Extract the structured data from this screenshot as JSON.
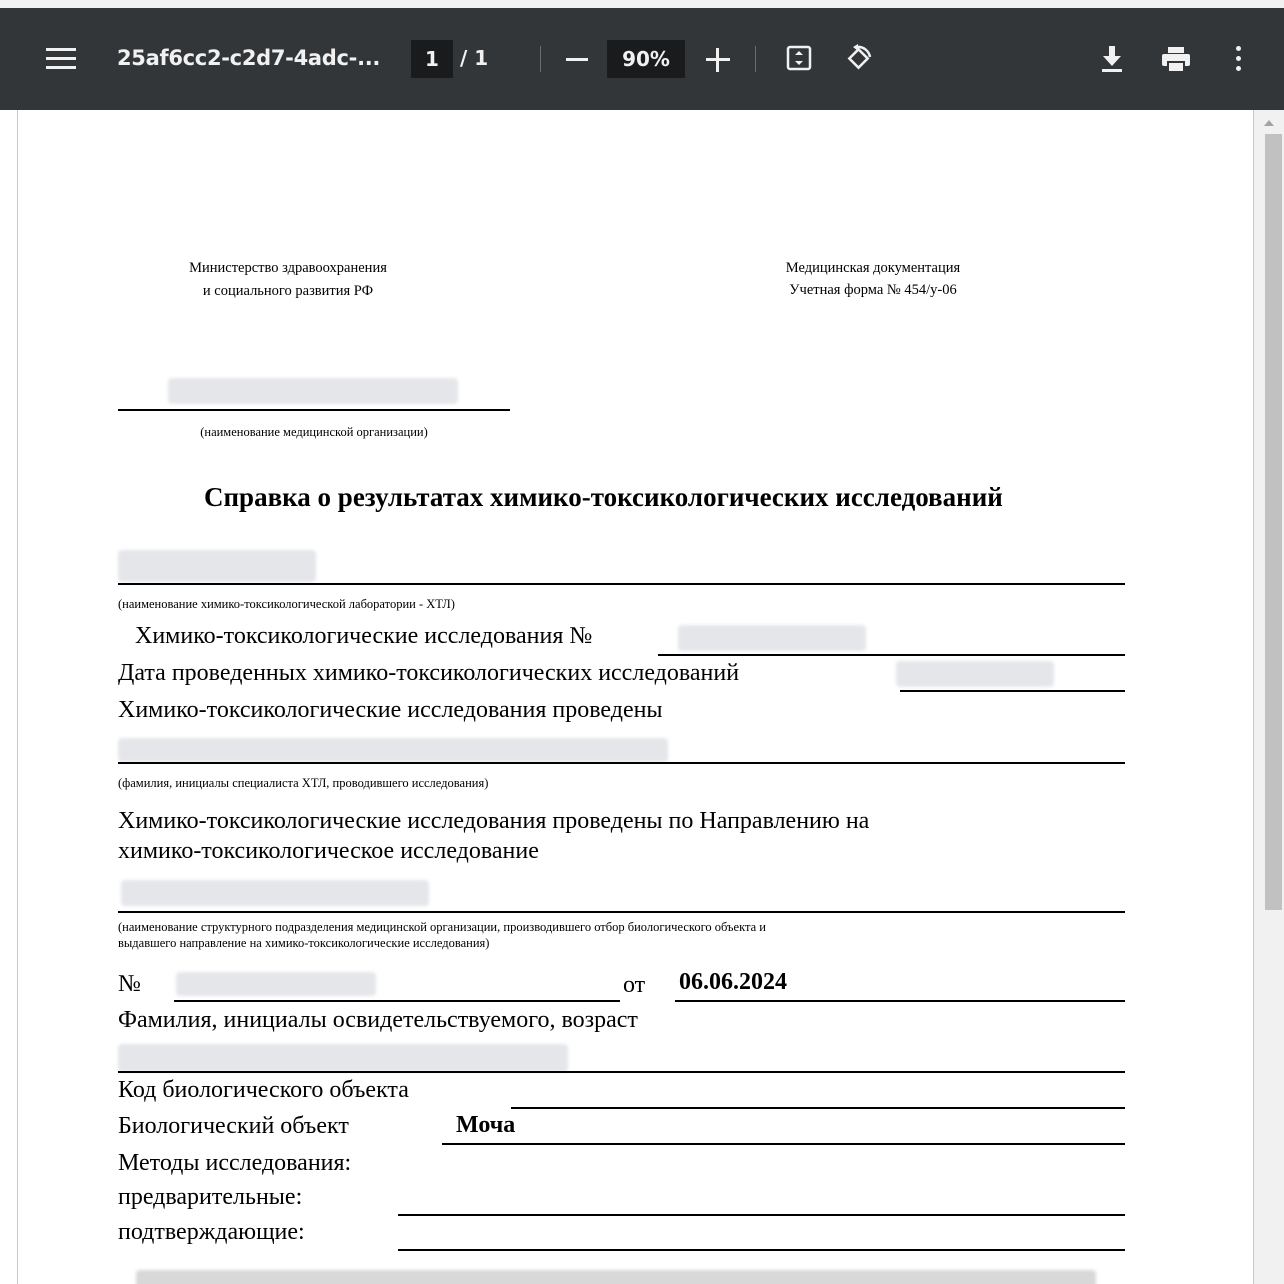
{
  "toolbar": {
    "file_title": "25af6cc2-c2d7-4adc-...",
    "current_page": "1",
    "page_total": "/ 1",
    "zoom": "90%"
  },
  "document": {
    "ministry_line1": "Министерство здравоохранения",
    "ministry_line2": "и социального развития РФ",
    "med_doc_line1": "Медицинская документация",
    "med_doc_line2": "Учетная форма № 454/у-06",
    "org_caption": "(наименование медицинской организации)",
    "title": "Справка о результатах  химико-токсикологических исследований",
    "lab_caption": "(наименование химико-токсикологической лаборатории - ХТЛ)",
    "research_number_label": "Химико-токсикологические исследования №",
    "research_date_label": "Дата проведенных химико-токсикологических исследований",
    "conducted_label": "Химико-токсикологические исследования проведены",
    "specialist_caption": "(фамилия, инициалы специалиста ХТЛ, проводившего исследования)",
    "referral_line1": "Химико-токсикологические исследования  проведены  по  Направлению  на",
    "referral_line2": "химико-токсикологическое исследование",
    "division_caption_line1": "(наименование структурного подразделения медицинской организации, производившего отбор биологического объекта и",
    "division_caption_line2": "выдавшего направление на химико-токсикологические исследования)",
    "number_label": "№",
    "from_label": "от",
    "referral_date": "06.06.2024",
    "subject_label": "Фамилия, инициалы освидетельствуемого, возраст",
    "bio_code_label": "Код биологического объекта",
    "bio_object_label": "Биологический объект",
    "bio_object_value": "Моча",
    "methods_label": "Методы исследования:",
    "preliminary_label": "предварительные:",
    "confirming_label": "подтверждающие:"
  }
}
